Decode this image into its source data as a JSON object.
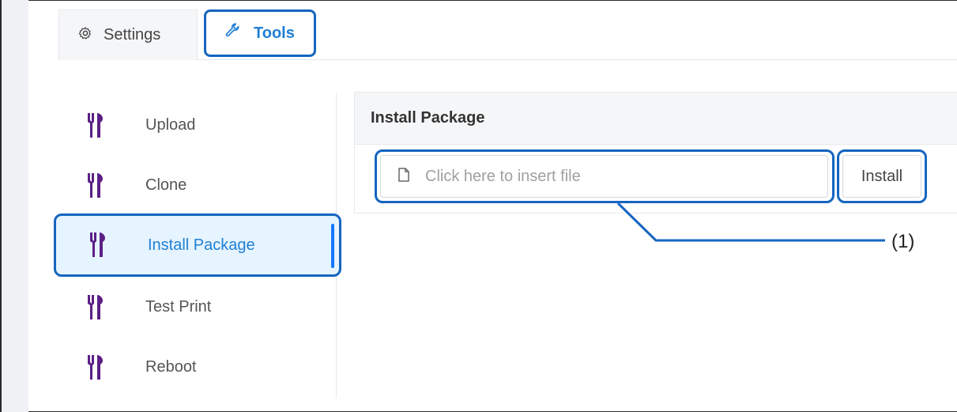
{
  "tabs": [
    {
      "label": "Settings",
      "icon": "gear-icon",
      "active": false
    },
    {
      "label": "Tools",
      "icon": "wrench-icon",
      "active": true
    }
  ],
  "sidebar": {
    "items": [
      {
        "label": "Upload",
        "icon": "tools-icon",
        "active": false
      },
      {
        "label": "Clone",
        "icon": "tools-icon",
        "active": false
      },
      {
        "label": "Install Package",
        "icon": "tools-icon",
        "active": true
      },
      {
        "label": "Test Print",
        "icon": "tools-icon",
        "active": false
      },
      {
        "label": "Reboot",
        "icon": "tools-icon",
        "active": false
      }
    ]
  },
  "panel": {
    "title": "Install Package",
    "file_input_placeholder": "Click here to insert file",
    "install_label": "Install"
  },
  "callout": {
    "label": "(1)"
  },
  "colors": {
    "accent": "#1f7fd6",
    "highlight_outline": "#1565c0",
    "active_background": "#e6f4ff",
    "tool_icon": "#6a1b9a"
  }
}
